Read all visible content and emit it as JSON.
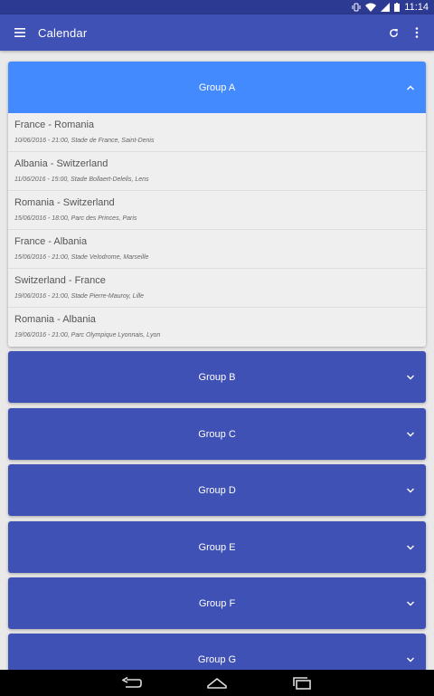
{
  "status_bar": {
    "time": "11:14"
  },
  "app_bar": {
    "title": "Calendar"
  },
  "groups": [
    {
      "name": "Group A",
      "expanded": true,
      "matches": [
        {
          "teams": "France  -  Romania",
          "info": "10/06/2016 - 21:00, Stade de France, Saint-Denis"
        },
        {
          "teams": "Albania  -  Switzerland",
          "info": "11/06/2016 - 15:00, Stade Bollaert-Delelis, Lens"
        },
        {
          "teams": "Romania  -  Switzerland",
          "info": "15/06/2016 - 18:00, Parc des Princes, Paris"
        },
        {
          "teams": "France  -  Albania",
          "info": "15/06/2016 - 21:00, Stade Velodrome, Marseille"
        },
        {
          "teams": "Switzerland  -  France",
          "info": "19/06/2016 - 21:00, Stade Pierre-Mauroy, Lille"
        },
        {
          "teams": "Romania  -  Albania",
          "info": "19/06/2016 - 21:00, Parc Olympique Lyonnais, Lyon"
        }
      ]
    },
    {
      "name": "Group B",
      "expanded": false
    },
    {
      "name": "Group C",
      "expanded": false
    },
    {
      "name": "Group D",
      "expanded": false
    },
    {
      "name": "Group E",
      "expanded": false
    },
    {
      "name": "Group F",
      "expanded": false
    },
    {
      "name": "Group G",
      "expanded": false
    }
  ],
  "colors": {
    "status_bar": "#2c3a91",
    "app_bar": "#3f51b5",
    "group_header": "#3f51b5",
    "group_header_expanded": "#448aff",
    "background": "#e9e9e9",
    "match_list": "#efefef"
  }
}
